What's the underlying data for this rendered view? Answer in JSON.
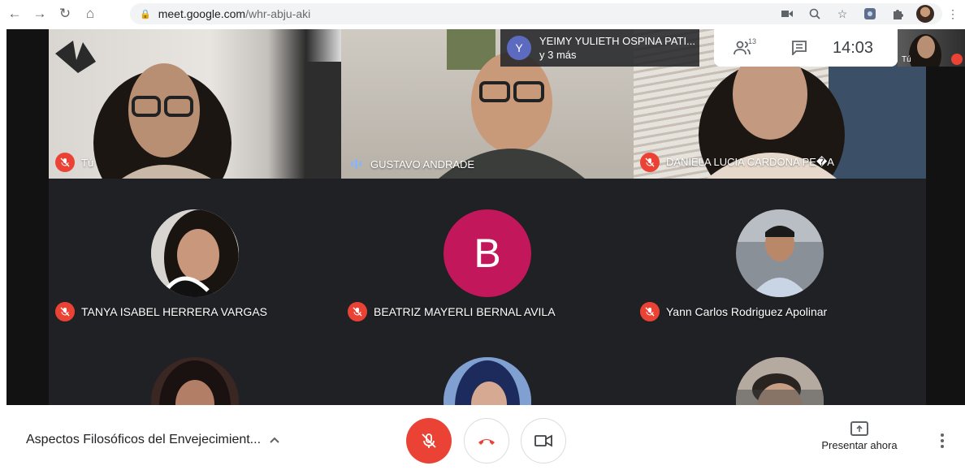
{
  "browser": {
    "url_host": "meet.google.com",
    "url_path": "/whr-abju-aki",
    "icons": [
      "back-arrow-icon",
      "forward-arrow-icon",
      "reload-icon",
      "home-icon",
      "lock-icon",
      "camera-icon",
      "zoom-icon",
      "star-icon",
      "extension-icon",
      "puzzle-icon",
      "profile-avatar",
      "menu-dots-icon"
    ]
  },
  "overlays": {
    "presenter_initial": "Y",
    "presenter_name": "YEIMY YULIETH OSPINA PATI...",
    "presenter_more": "y 3 más",
    "participant_count": "13",
    "clock": "14:03",
    "self_label": "Tú"
  },
  "video_tiles": [
    {
      "name": "Tú",
      "muted": true
    },
    {
      "name": "GUSTAVO ANDRADE",
      "speaking": true
    },
    {
      "name": "DANIELA LUCIA CARDONA PE�A",
      "muted": true
    }
  ],
  "grid_tiles": [
    {
      "name": "TANYA ISABEL HERRERA VARGAS",
      "muted": true,
      "avatar": "photo"
    },
    {
      "name": "BEATRIZ MAYERLI BERNAL AVILA",
      "muted": true,
      "avatar": "letter",
      "letter": "B",
      "color": "#c2185b"
    },
    {
      "name": "Yann Carlos Rodriguez Apolinar",
      "muted": true,
      "avatar": "photo"
    }
  ],
  "bottom": {
    "meeting_title": "Aspectos Filosóficos del Envejecimient...",
    "present_label": "Presentar ahora"
  },
  "colors": {
    "red": "#ea4335",
    "stage": "#202124"
  }
}
